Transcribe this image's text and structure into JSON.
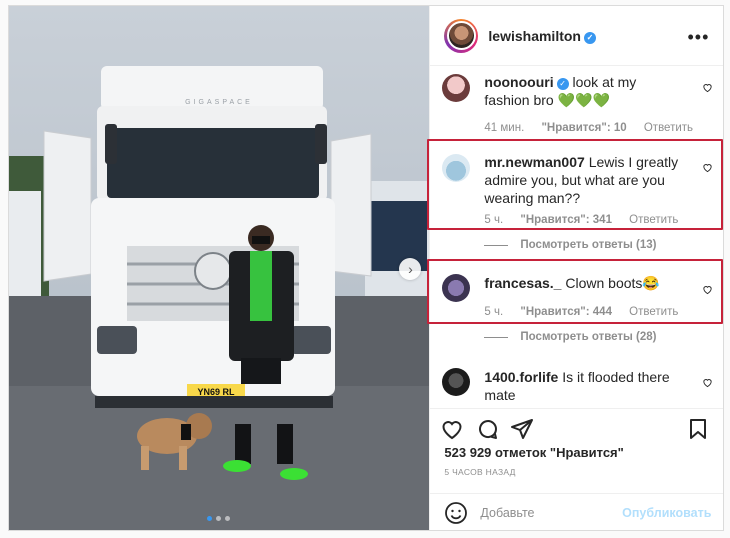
{
  "post": {
    "author": "lewishamilton",
    "verified_icon": "verified-badge-icon"
  },
  "comments": [
    {
      "user": "noonoouri",
      "text": "look at my fashion bro",
      "emoji": "💚💚💚",
      "time": "41 мин.",
      "likes": "\"Нравится\": 10",
      "reply": "Ответить"
    },
    {
      "user": "mr.newman007",
      "text": "Lewis I greatly admire you, but what are you wearing man??",
      "time": "5 ч.",
      "likes": "\"Нравится\": 341",
      "reply": "Ответить",
      "view_replies": "Посмотреть ответы (13)"
    },
    {
      "user": "francesas._",
      "text": "Clown boots😂",
      "time": "5 ч.",
      "likes": "\"Нравится\": 444",
      "reply": "Ответить",
      "view_replies": "Посмотреть ответы (28)"
    },
    {
      "user": "1400.forlife",
      "text": "Is it flooded there mate"
    }
  ],
  "footer": {
    "likes_count": "523 929 отметок \"Нравится\"",
    "time_ago": "5 ЧАСОВ НАЗАД",
    "comment_placeholder": "Добавьте",
    "publish_label": "Опубликовать"
  },
  "photo": {
    "truck_logo_text": "GIGASPACE",
    "license_plate": "YN69 RL",
    "carousel_dots": 3,
    "active_dot": 1
  },
  "colors": {
    "highlight": "#c6223a",
    "accent": "#3897f0",
    "publish_disabled": "#b2dffc"
  }
}
